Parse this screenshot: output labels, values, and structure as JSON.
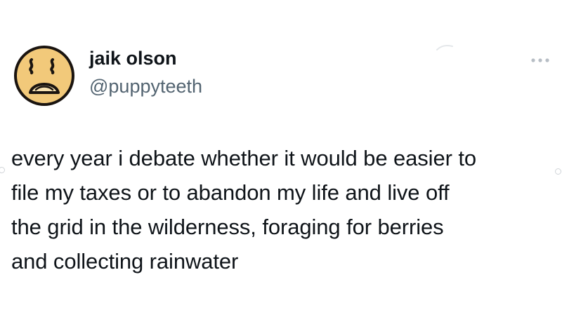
{
  "tweet": {
    "author": {
      "display_name": "jaik olson",
      "handle": "@puppyteeth",
      "avatar_icon": "sad-face-icon"
    },
    "more_icon": "more-horizontal-icon",
    "text_lines": [
      "every year i debate whether it would be easier to",
      "file my taxes or to abandon my life and live off",
      "the grid in the wilderness, foraging for berries",
      "and collecting rainwater"
    ]
  },
  "colors": {
    "text": "#0f1419",
    "handle": "#536471",
    "avatar_face": "#f2c97a",
    "avatar_outline": "#1a1410",
    "background": "#ffffff"
  }
}
